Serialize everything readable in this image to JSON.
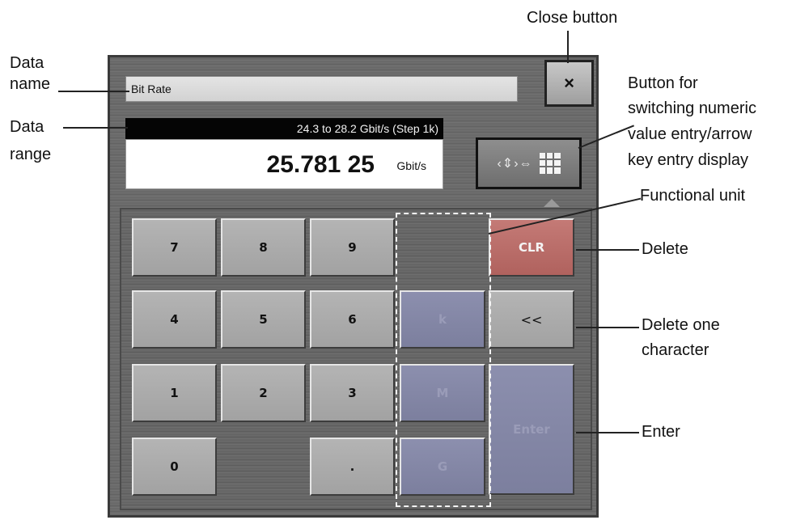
{
  "dialog": {
    "data_name": "Bit Rate",
    "close_symbol": "×",
    "range_text": "24.3 to 28.2 Gbit/s (Step 1k)",
    "value": "25.781 25",
    "unit": "Gbit/s",
    "mode_button": {
      "arrows": "‹⇕›⇔",
      "grid_icon": "keypad-grid-icon"
    }
  },
  "keypad": {
    "k7": "7",
    "k8": "8",
    "k9": "9",
    "k4": "4",
    "k5": "5",
    "k6": "6",
    "k1": "1",
    "k2": "2",
    "k3": "3",
    "k0": "0",
    "dot": ".",
    "clr": "CLR",
    "back": "<<",
    "unit_k": "k",
    "unit_M": "M",
    "unit_G": "G",
    "enter": "Enter"
  },
  "annotations": {
    "close_button": "Close button",
    "data_name_1": "Data",
    "data_name_2": "name",
    "data_range_1": "Data",
    "data_range_2": "range",
    "switch_1": "Button for",
    "switch_2": "switching numeric",
    "switch_3": "value entry/arrow",
    "switch_4": "key entry display",
    "functional_unit": "Functional unit",
    "delete": "Delete",
    "delete_one_1": "Delete one",
    "delete_one_2": "character",
    "enter": "Enter"
  },
  "colors": {
    "clr_key": "#b86a66",
    "unit_keys": "#8487a6",
    "panel": "#6a6a6a"
  }
}
